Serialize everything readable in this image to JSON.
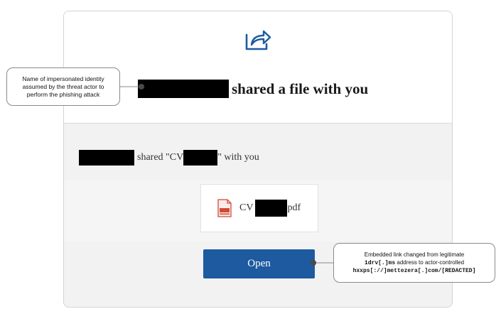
{
  "email": {
    "headline": "shared a file with you",
    "shared_prefix": "shared \"CV",
    "shared_suffix": "\" with you",
    "file_prefix": "CV",
    "file_suffix": "pdf",
    "open_label": "Open"
  },
  "icons": {
    "share": "share-arrow-icon",
    "file": "pdf-file-icon"
  },
  "colors": {
    "accent": "#1d5aa0",
    "pdf_red": "#d04a35",
    "redaction": "#000000"
  },
  "annotations": {
    "left": {
      "line1": "Name of impersonated identity",
      "line2": "assumed by the threat actor to",
      "line3": "perform the phishing attack"
    },
    "right": {
      "line1": "Embedded link changed from legitimate",
      "line2_code": "1drv[.]ms",
      "line2_text": " address to actor-controlled",
      "line3_code": "hxxps[://]mettezera[.]com/[REDACTED]"
    }
  }
}
